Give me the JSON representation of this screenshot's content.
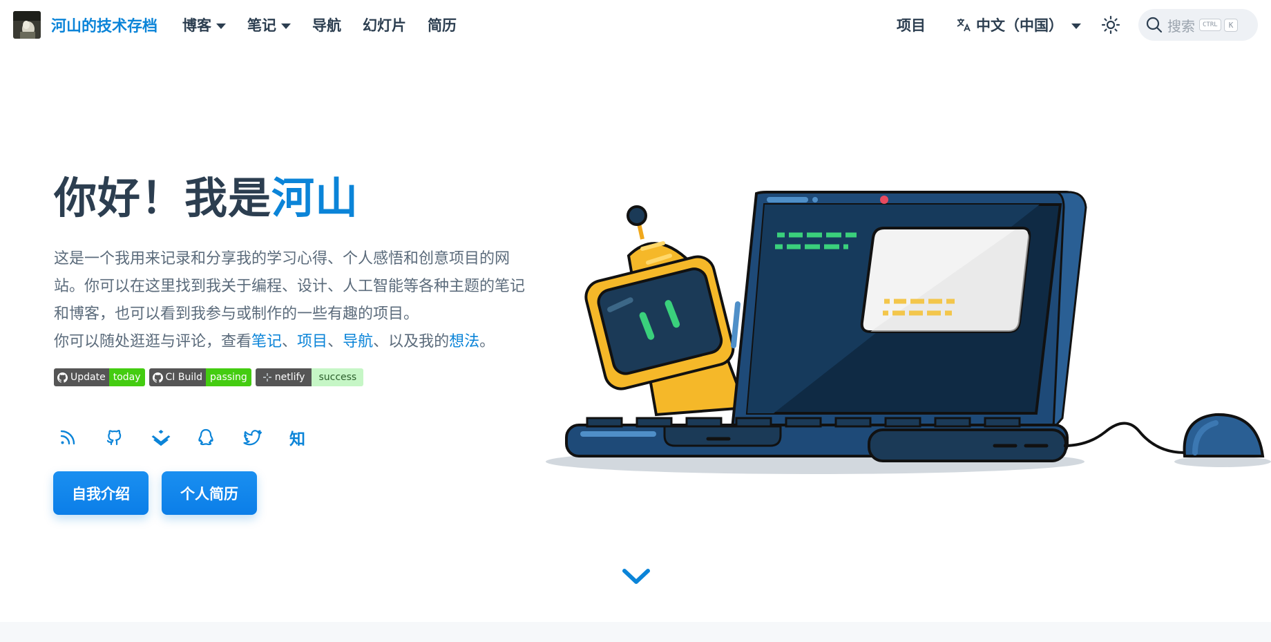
{
  "navbar": {
    "brand": "河山的技术存档",
    "items": [
      {
        "label": "博客",
        "dropdown": true
      },
      {
        "label": "笔记",
        "dropdown": true
      },
      {
        "label": "导航",
        "dropdown": false
      },
      {
        "label": "幻灯片",
        "dropdown": false
      },
      {
        "label": "简历",
        "dropdown": false
      }
    ],
    "projects_label": "项目",
    "language_label": "中文（中国）",
    "search_placeholder": "搜索",
    "search_key_ctrl": "CTRL",
    "search_key_k": "K"
  },
  "hero": {
    "title_prefix": "你好！我是",
    "title_name": "河山",
    "desc_line1": "这是一个我用来记录和分享我的学习心得、个人感悟和创意项目的网站。你可以在这里找到我关于编程、设计、人工智能等各种主题的笔记和博客，也可以看到我参与或制作的一些有趣的项目。",
    "desc_line2_prefix": "你可以随处逛逛与评论，查看",
    "link_notes": "笔记",
    "sep1": "、",
    "link_projects": "项目",
    "sep2": "、",
    "link_nav": "导航",
    "desc_line2_mid": "、以及我的",
    "link_thoughts": "想法",
    "desc_line2_end": "。"
  },
  "badges": [
    {
      "left": "Update",
      "right": "today"
    },
    {
      "left": "CI Build",
      "right": "passing"
    },
    {
      "left": "netlify",
      "right": "success"
    }
  ],
  "socials": {
    "zhihu_label": "知"
  },
  "actions": {
    "about_label": "自我介绍",
    "resume_label": "个人简历"
  },
  "colors": {
    "accent": "#0b84d8",
    "text": "#2c3e50",
    "badge_green": "#44cc11"
  }
}
